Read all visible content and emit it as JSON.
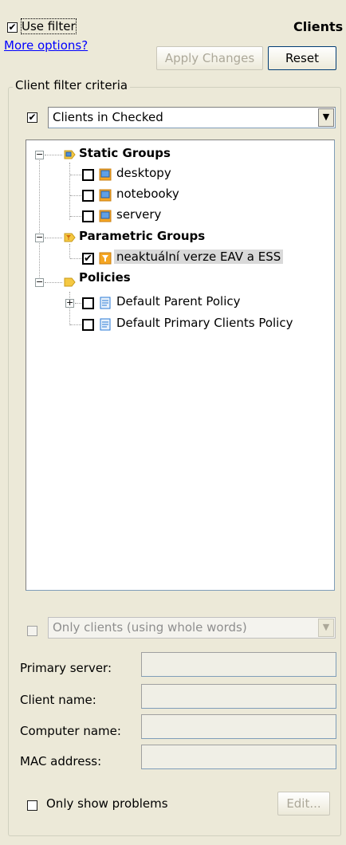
{
  "header": {
    "use_filter_label": "Use filter",
    "use_filter_checked": true,
    "title": "Clients",
    "more_options_link": "More options?",
    "apply_changes_label": "Apply Changes",
    "reset_label": "Reset"
  },
  "criteria": {
    "group_label": "Client filter criteria",
    "scope_checked": true,
    "scope_value": "Clients in Checked"
  },
  "tree": {
    "static_groups": {
      "label": "Static Groups",
      "children": [
        {
          "label": "desktopy",
          "checked": false
        },
        {
          "label": "notebooky",
          "checked": false
        },
        {
          "label": "servery",
          "checked": false
        }
      ]
    },
    "parametric_groups": {
      "label": "Parametric Groups",
      "children": [
        {
          "label": "neaktuální verze EAV a ESS",
          "checked": true
        }
      ]
    },
    "policies": {
      "label": "Policies",
      "children": [
        {
          "label": "Default Parent Policy",
          "checked": false
        },
        {
          "label": "Default Primary Clients Policy",
          "checked": false
        }
      ]
    }
  },
  "search": {
    "only_clients_checked": false,
    "only_clients_value": "Only clients (using whole words)"
  },
  "fields": {
    "primary_server_label": "Primary server:",
    "client_name_label": "Client name:",
    "computer_name_label": "Computer name:",
    "mac_address_label": "MAC address:"
  },
  "footer": {
    "only_show_problems_label": "Only show problems",
    "edit_label": "Edit..."
  }
}
